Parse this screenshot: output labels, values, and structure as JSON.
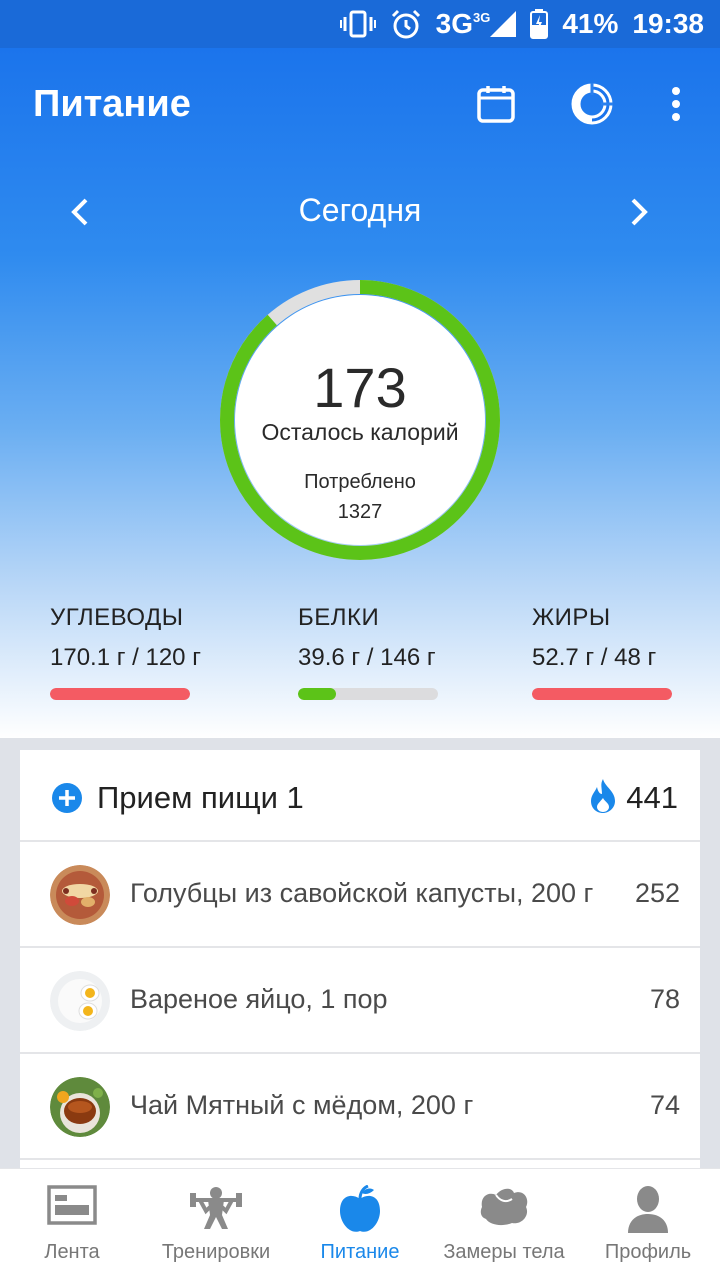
{
  "status_bar": {
    "icons": [
      "vibrate-icon",
      "alarm-icon",
      "signal-3g-icon",
      "battery-icon"
    ],
    "network": "3G",
    "network_small": "3G",
    "battery": "41%",
    "time": "19:38"
  },
  "app_bar": {
    "title": "Питание",
    "actions": [
      "calendar-icon",
      "donut-chart-icon",
      "more-vert-icon"
    ]
  },
  "date_nav": {
    "label": "Сегодня"
  },
  "calories": {
    "remaining": "173",
    "remaining_label": "Осталось калорий",
    "consumed_label": "Потреблено",
    "consumed": "1327",
    "progress": 0.885,
    "ring_color": "#5cc318",
    "ring_bg_color": "#e0e0e0"
  },
  "macros": [
    {
      "name": "УГЛЕВОДЫ",
      "value": "170.1 г / 120 г",
      "progress": 1.0,
      "color": "#f45b63"
    },
    {
      "name": "БЕЛКИ",
      "value": "39.6 г / 146 г",
      "progress": 0.27,
      "color": "#5cc318"
    },
    {
      "name": "ЖИРЫ",
      "value": "52.7 г / 48 г",
      "progress": 1.0,
      "color": "#f45b63"
    }
  ],
  "meal": {
    "title": "Прием пищи 1",
    "kcal": "441",
    "items": [
      {
        "name": "Голубцы из савойской капусты, 200 г",
        "kcal": "252"
      },
      {
        "name": "Вареное яйцо, 1 пор",
        "kcal": "78"
      },
      {
        "name": "Чай Мятный с мёдом, 200 г",
        "kcal": "74"
      }
    ]
  },
  "bottom_nav": {
    "items": [
      {
        "label": "Лента",
        "icon": "feed-icon"
      },
      {
        "label": "Тренировки",
        "icon": "workout-icon"
      },
      {
        "label": "Питание",
        "icon": "apple-icon",
        "active": true
      },
      {
        "label": "Замеры тела",
        "icon": "bicep-icon"
      },
      {
        "label": "Профиль",
        "icon": "profile-icon"
      }
    ],
    "active_color": "#1a88ea",
    "inactive_color": "#777777"
  },
  "colors": {
    "primary": "#1a6ad8",
    "accent": "#1a88ea",
    "ok": "#5cc318",
    "over": "#f45b63"
  }
}
